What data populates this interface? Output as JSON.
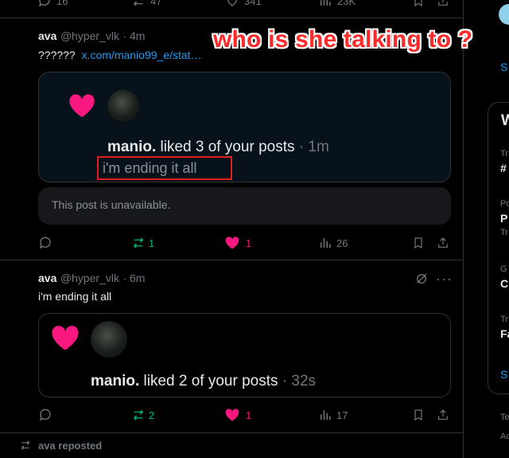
{
  "top_actions": {
    "replies": "16",
    "reposts": "47",
    "likes": "341",
    "views": "23K"
  },
  "overlay_caption": "who is she talking to ?",
  "post1": {
    "author": "ava",
    "handle": "@hyper_vlk",
    "time": "· 4m",
    "text": "??????",
    "link": "x.com/manio99_e/stat…",
    "quote": {
      "notif_name": "manio.",
      "notif_action": " liked 3 of your posts",
      "notif_time": " · 1m",
      "notif_preview": "i'm ending it all"
    },
    "unavailable": "This post is unavailable.",
    "actions": {
      "reposts": "1",
      "likes": "1",
      "views": "26"
    }
  },
  "post2": {
    "author": "ava",
    "handle": "@hyper_vlk",
    "time": "· 6m",
    "text": "i'm ending it all",
    "quote": {
      "notif_name": "manio.",
      "notif_action": " liked 2 of your posts",
      "notif_time": " · 32s"
    },
    "actions": {
      "reposts": "2",
      "likes": "1",
      "views": "17"
    }
  },
  "repost_bar": {
    "text": "ava reposted"
  },
  "sidebar": {
    "links": [
      "S",
      "S"
    ],
    "panel_title": "W",
    "items": [
      {
        "line1": "Tr",
        "line2": "#"
      },
      {
        "line1": "Po",
        "line2": "P",
        "line3": "Tr"
      },
      {
        "line1": "G",
        "line2": "C"
      },
      {
        "line1": "Tr",
        "line2": "Fa"
      }
    ],
    "footer1": "Te",
    "footer2": "Ac"
  },
  "colors": {
    "like": "#f91880",
    "repost": "#00ba7c",
    "link": "#1d9bf0",
    "muted": "#71767b",
    "annotation": "#ff2a2a"
  }
}
